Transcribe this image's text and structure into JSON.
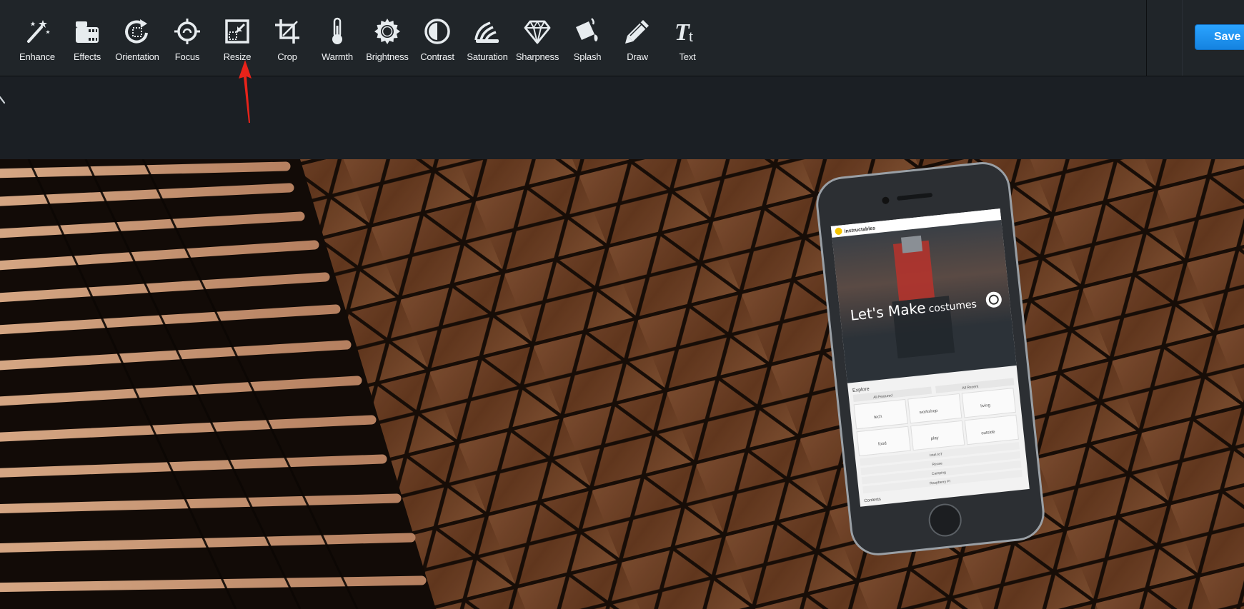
{
  "toolbar": {
    "tools": [
      {
        "label": "Enhance",
        "icon": "magic-wand-icon"
      },
      {
        "label": "Effects",
        "icon": "film-icon"
      },
      {
        "label": "Orientation",
        "icon": "rotate-icon"
      },
      {
        "label": "Focus",
        "icon": "focus-icon"
      },
      {
        "label": "Resize",
        "icon": "resize-icon"
      },
      {
        "label": "Crop",
        "icon": "crop-icon"
      },
      {
        "label": "Warmth",
        "icon": "thermometer-icon"
      },
      {
        "label": "Brightness",
        "icon": "sun-icon"
      },
      {
        "label": "Contrast",
        "icon": "contrast-icon"
      },
      {
        "label": "Saturation",
        "icon": "saturation-icon"
      },
      {
        "label": "Sharpness",
        "icon": "diamond-icon"
      },
      {
        "label": "Splash",
        "icon": "paint-bucket-icon"
      },
      {
        "label": "Draw",
        "icon": "pencil-icon"
      },
      {
        "label": "Text",
        "icon": "text-icon"
      }
    ],
    "save_label": "Save",
    "accent": "#1d8ff0",
    "annotation_color": "#e8231a"
  },
  "photo": {
    "phone": {
      "site_name": "instructables",
      "hero_text": "Let's Make",
      "hero_word": "costumes",
      "explore_label": "Explore",
      "all_featured": "All Featured",
      "all_recent": "All Recent",
      "categories": [
        "tech",
        "workshop",
        "living",
        "food",
        "play",
        "outside"
      ],
      "channels": [
        "Intel IoT",
        "Reuse",
        "Camping",
        "Raspberry Pi"
      ],
      "contests_label": "Contests"
    }
  }
}
